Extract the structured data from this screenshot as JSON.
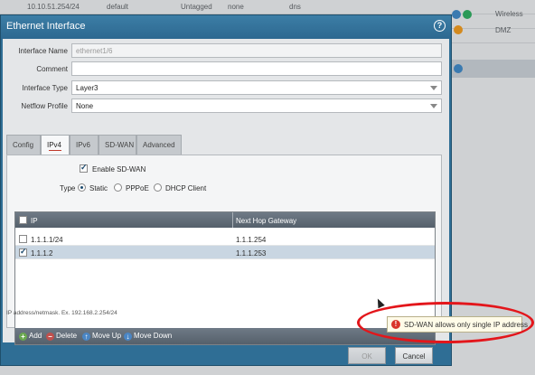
{
  "background": {
    "row1": [
      "10.10.51.254/24",
      "default",
      "Untagged",
      "none",
      "dns"
    ],
    "side_labels": [
      "Wireless",
      "DMZ"
    ]
  },
  "dialog": {
    "title": "Ethernet Interface",
    "help_icon": "?",
    "fields": {
      "interface_name_label": "Interface Name",
      "interface_name_value": "ethernet1/6",
      "comment_label": "Comment",
      "comment_value": "",
      "interface_type_label": "Interface Type",
      "interface_type_value": "Layer3",
      "netflow_label": "Netflow Profile",
      "netflow_value": "None"
    },
    "tabs": [
      "Config",
      "IPv4",
      "IPv6",
      "SD-WAN",
      "Advanced"
    ],
    "active_tab": "IPv4",
    "enable_sdwan_label": "Enable SD-WAN",
    "type_label": "Type",
    "type_options": [
      "Static",
      "PPPoE",
      "DHCP Client"
    ],
    "type_selected": "Static",
    "grid": {
      "columns": [
        "IP",
        "Next Hop Gateway"
      ],
      "rows": [
        {
          "ip": "1.1.1.1/24",
          "gateway": "1.1.1.254",
          "checked": false
        },
        {
          "ip": "1.1.1.2",
          "gateway": "1.1.1.253",
          "checked": true
        }
      ],
      "toolbar": [
        "Add",
        "Delete",
        "Move Up",
        "Move Down"
      ]
    },
    "hint": "IP address/netmask. Ex. 192.168.2.254/24",
    "ok_label": "OK",
    "cancel_label": "Cancel"
  },
  "tooltip": {
    "icon": "!",
    "message": "SD-WAN allows only single IP address"
  },
  "colors": {
    "dialog_blue": "#2f6e95",
    "error_red": "#d9342b",
    "annotation_red": "#e3161b"
  }
}
